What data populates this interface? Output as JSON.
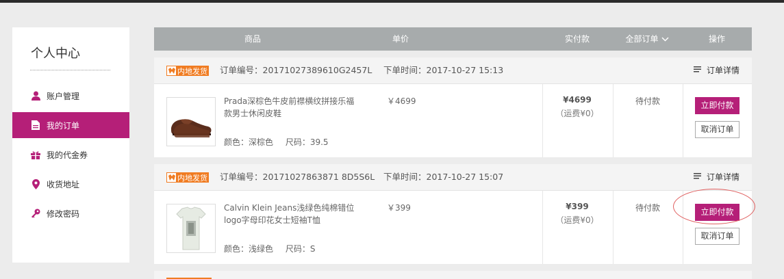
{
  "sidebar": {
    "title": "个人中心",
    "items": [
      {
        "label": "账户管理",
        "icon": "user-icon"
      },
      {
        "label": "我的订单",
        "icon": "document-icon",
        "active": true
      },
      {
        "label": "我的代金券",
        "icon": "gift-icon"
      },
      {
        "label": "收货地址",
        "icon": "location-pin-icon"
      },
      {
        "label": "修改密码",
        "icon": "key-icon"
      }
    ]
  },
  "table_header": {
    "product": "商品",
    "unit_price": "单价",
    "paid": "实付款",
    "all_orders": "全部订单",
    "all_orders_icon": "chevron-down-icon",
    "action": "操作"
  },
  "orders": [
    {
      "badge": "内地发货",
      "order_no": "订单编号：20171027389610G2457L",
      "order_time": "下单时间：2017-10-27 15:13",
      "detail_label": "订单详情",
      "product_name": "Prada深棕色牛皮前襟横纹拼接乐福款男士休闲皮鞋",
      "color": "颜色：深棕色",
      "size": "尺码：39.5",
      "unit_price": "￥4699",
      "paid_amount": "¥4699",
      "shipping": "（运费¥0）",
      "status": "待付款",
      "pay_label": "立即付款",
      "cancel_label": "取消订单"
    },
    {
      "badge": "内地发货",
      "order_no": "订单编号：20171027863871 8D5S6L",
      "order_time": "下单时间：2017-10-27 15:07",
      "detail_label": "订单详情",
      "product_name": "Calvin Klein Jeans浅绿色纯棉错位logo字母印花女士短袖T恤",
      "color": "颜色：浅绿色",
      "size": "尺码：S",
      "unit_price": "￥399",
      "paid_amount": "¥399",
      "shipping": "（运费¥0）",
      "status": "待付款",
      "pay_label": "立即付款",
      "cancel_label": "取消订单"
    }
  ],
  "colors": {
    "accent": "#b51f78",
    "badge": "#f07c22",
    "header": "#a7abac"
  }
}
